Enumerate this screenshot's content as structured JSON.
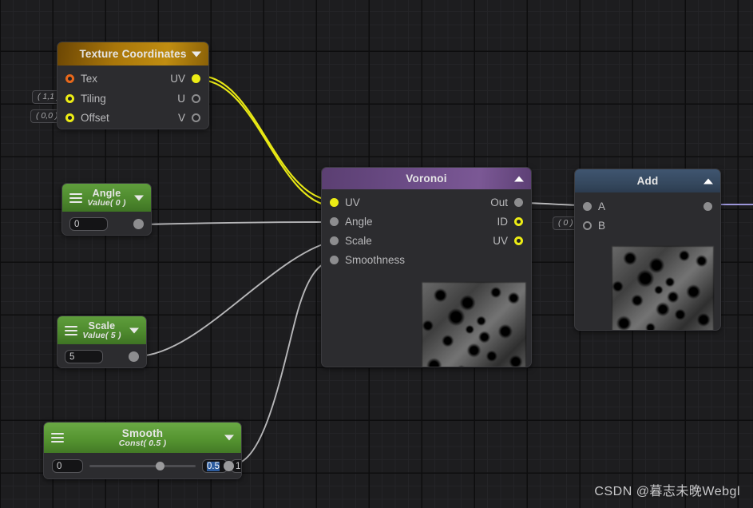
{
  "editor": {
    "background_color": "#1d1d1f",
    "grid_minor_color": "#242427",
    "grid_major_color": "#0d0d0e",
    "watermark": "CSDN @暮志未晚Webgl"
  },
  "nodes": {
    "texture_coordinates": {
      "title": "Texture Coordinates",
      "header_color": "#b5820d",
      "collapse_icon": "chevron-down-icon",
      "inputs": [
        {
          "label": "Tex",
          "port": "ring-orange",
          "default": ""
        },
        {
          "label": "Tiling",
          "port": "ring-yellow",
          "default": "( 1,1 )"
        },
        {
          "label": "Offset",
          "port": "ring-yellow",
          "default": "( 0,0 )"
        }
      ],
      "outputs": [
        {
          "label": "UV",
          "port": "fill-yellow"
        },
        {
          "label": "U",
          "port": "ring-grey"
        },
        {
          "label": "V",
          "port": "ring-grey"
        }
      ]
    },
    "angle": {
      "title": "Angle",
      "subtitle": "Value( 0 )",
      "header_color": "#4e8a2e",
      "menu_icon": "hamburger-icon",
      "collapse_icon": "chevron-down-icon",
      "value": "0"
    },
    "scale": {
      "title": "Scale",
      "subtitle": "Value( 5 )",
      "header_color": "#4e8a2e",
      "menu_icon": "hamburger-icon",
      "collapse_icon": "chevron-down-icon",
      "value": "5"
    },
    "smooth": {
      "title": "Smooth",
      "subtitle": "Const( 0.5 )",
      "header_color": "#559430",
      "menu_icon": "hamburger-icon",
      "collapse_icon": "chevron-down-icon",
      "min": "0",
      "value": "0.5",
      "max": "1",
      "handle_percent": 50
    },
    "voronoi": {
      "title": "Voronoi",
      "header_color": "#6d4d88",
      "collapse_icon": "chevron-up-icon",
      "inputs": [
        {
          "label": "UV",
          "port": "fill-yellow"
        },
        {
          "label": "Angle",
          "port": "fill-grey"
        },
        {
          "label": "Scale",
          "port": "fill-grey"
        },
        {
          "label": "Smoothness",
          "port": "fill-grey"
        }
      ],
      "outputs": [
        {
          "label": "Out",
          "port": "fill-grey"
        },
        {
          "label": "ID",
          "port": "ring-yellow"
        },
        {
          "label": "UV",
          "port": "ring-yellow"
        }
      ],
      "preview": "voronoi-noise-preview"
    },
    "add": {
      "title": "Add",
      "header_color": "#35485e",
      "collapse_icon": "chevron-up-icon",
      "inputs": [
        {
          "label": "A",
          "port": "fill-grey",
          "default": ""
        },
        {
          "label": "B",
          "port": "ring-grey",
          "default": "( 0 )"
        }
      ],
      "outputs": [
        {
          "label": "",
          "port": "fill-grey"
        }
      ],
      "preview": "add-noise-preview"
    }
  },
  "wires": [
    {
      "from": "texture_coordinates.UV",
      "to": "voronoi.UV",
      "color": "#e8e815",
      "double": true
    },
    {
      "from": "angle.out",
      "to": "voronoi.Angle",
      "color": "#b6b6b8",
      "double": false
    },
    {
      "from": "scale.out",
      "to": "voronoi.Scale",
      "color": "#b6b6b8",
      "double": false
    },
    {
      "from": "smooth.out",
      "to": "voronoi.Smoothness",
      "color": "#b6b6b8",
      "double": false
    },
    {
      "from": "voronoi.Out",
      "to": "add.A",
      "color": "#b6b6b8",
      "double": false
    },
    {
      "from": "add.out",
      "to": "offscreen",
      "color": "#9b95d8",
      "double": false
    }
  ]
}
